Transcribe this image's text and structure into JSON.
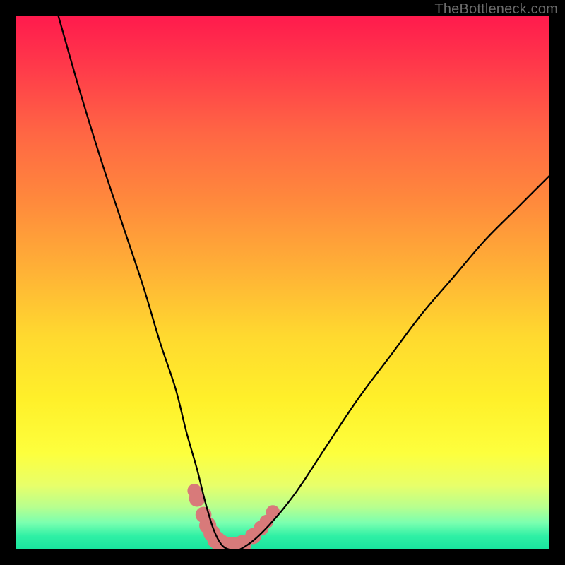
{
  "watermark": "TheBottleneck.com",
  "chart_data": {
    "type": "line",
    "title": "",
    "xlabel": "",
    "ylabel": "",
    "xlim": [
      0,
      100
    ],
    "ylim": [
      0,
      100
    ],
    "series": [
      {
        "name": "curve",
        "x": [
          8,
          12,
          16,
          20,
          24,
          27,
          30,
          32,
          34,
          35.5,
          37,
          38.5,
          40,
          42,
          46,
          52,
          58,
          64,
          70,
          76,
          82,
          88,
          94,
          100
        ],
        "values": [
          100,
          86,
          73,
          61,
          49,
          39,
          30,
          22,
          15,
          9,
          4,
          1,
          0,
          0,
          3,
          10,
          19,
          28,
          36,
          44,
          51,
          58,
          64,
          70
        ]
      }
    ],
    "markers": [
      {
        "x": 33.5,
        "y": 11,
        "r": 1.3
      },
      {
        "x": 34.0,
        "y": 9.5,
        "r": 1.5
      },
      {
        "x": 35.2,
        "y": 6.5,
        "r": 1.5
      },
      {
        "x": 36.0,
        "y": 4.5,
        "r": 1.6
      },
      {
        "x": 36.8,
        "y": 3.0,
        "r": 1.6
      },
      {
        "x": 37.6,
        "y": 1.8,
        "r": 1.7
      },
      {
        "x": 38.5,
        "y": 1.0,
        "r": 1.8
      },
      {
        "x": 39.5,
        "y": 0.6,
        "r": 1.8
      },
      {
        "x": 40.5,
        "y": 0.5,
        "r": 1.8
      },
      {
        "x": 41.5,
        "y": 0.6,
        "r": 1.8
      },
      {
        "x": 42.5,
        "y": 1.0,
        "r": 1.7
      },
      {
        "x": 44.5,
        "y": 2.5,
        "r": 1.5
      },
      {
        "x": 46.0,
        "y": 4.0,
        "r": 1.4
      },
      {
        "x": 47.0,
        "y": 5.2,
        "r": 1.3
      },
      {
        "x": 48.2,
        "y": 7.0,
        "r": 1.3
      }
    ],
    "colors": {
      "curve": "#000000",
      "markers": "#d87a7a"
    }
  }
}
